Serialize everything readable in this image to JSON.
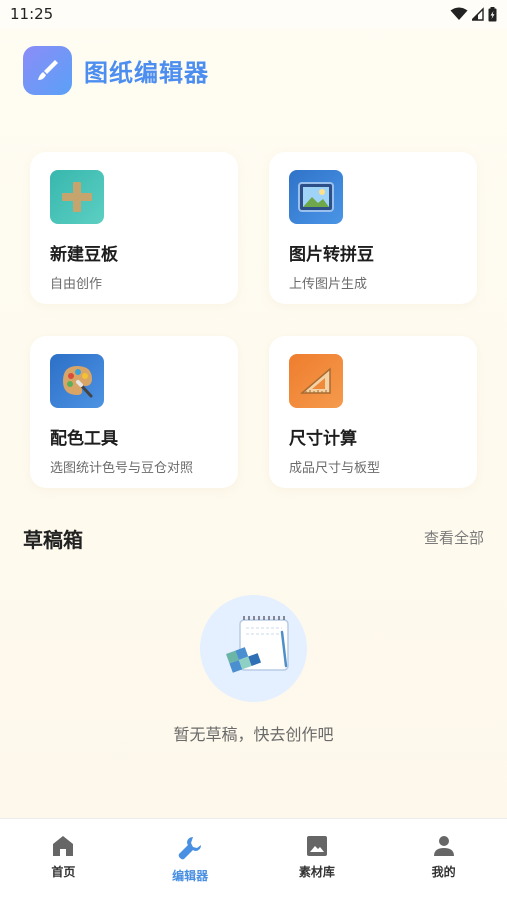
{
  "status_bar": {
    "time": "11:25"
  },
  "header": {
    "app_title": "图纸编辑器",
    "logo_icon": "brush-icon",
    "accent_color": "#4c8df0"
  },
  "features": [
    {
      "title": "新建豆板",
      "subtitle": "自由创作",
      "icon": "plus-icon",
      "icon_bg": "#47c1b7"
    },
    {
      "title": "图片转拼豆",
      "subtitle": "上传图片生成",
      "icon": "image-icon",
      "icon_bg": "#3f86d9"
    },
    {
      "title": "配色工具",
      "subtitle": "选图统计色号与豆仓对照",
      "icon": "palette-icon",
      "icon_bg": "#3e86d6"
    },
    {
      "title": "尺寸计算",
      "subtitle": "成品尺寸与板型",
      "icon": "ruler-triangle-icon",
      "icon_bg": "#f08a3a"
    }
  ],
  "drafts": {
    "title": "草稿箱",
    "view_all": "查看全部",
    "empty_text": "暂无草稿，快去创作吧"
  },
  "bottom_nav": [
    {
      "label": "首页",
      "icon": "home-icon",
      "active": false
    },
    {
      "label": "编辑器",
      "icon": "wrench-icon",
      "active": true
    },
    {
      "label": "素材库",
      "icon": "image-icon",
      "active": false
    },
    {
      "label": "我的",
      "icon": "person-icon",
      "active": false
    }
  ]
}
